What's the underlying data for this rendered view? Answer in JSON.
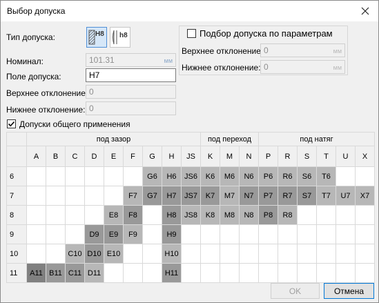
{
  "window": {
    "title": "Выбор допуска"
  },
  "form": {
    "tol_type_label": "Тип допуска:",
    "tol_hole_label": "H8",
    "tol_shaft_label": "h8",
    "nominal_label": "Номинал:",
    "nominal_value": "101.31",
    "unit": "мм",
    "field_label": "Поле допуска:",
    "field_value": "H7",
    "upper_label": "Верхнее отклонение:",
    "upper_value": "0",
    "lower_label": "Нижнее отклонение:",
    "lower_value": "0",
    "general_label": "Допуски общего применения"
  },
  "params": {
    "checkbox_label": "Подбор допуска по параметрам",
    "upper_label": "Верхнее отклонение:",
    "upper_value": "0",
    "lower_label": "Нижнее отклонение:",
    "lower_value": "0",
    "unit": "мм"
  },
  "grid": {
    "groups": [
      "под зазор",
      "под переход",
      "под натяг"
    ],
    "columns": [
      "A",
      "B",
      "C",
      "D",
      "E",
      "F",
      "G",
      "H",
      "JS",
      "K",
      "M",
      "N",
      "P",
      "R",
      "S",
      "T",
      "U",
      "X"
    ],
    "rows": [
      {
        "label": "6",
        "cells": [
          "",
          "",
          "",
          "",
          "",
          "",
          "G6",
          "H6",
          "JS6",
          "K6",
          "M6",
          "N6",
          "P6",
          "R6",
          "S6",
          "T6",
          "",
          ""
        ]
      },
      {
        "label": "7",
        "cells": [
          "",
          "",
          "",
          "",
          "",
          "F7",
          "G7",
          "H7",
          "JS7",
          "K7",
          "M7",
          "N7",
          "P7",
          "R7",
          "S7",
          "T7",
          "U7",
          "X7"
        ]
      },
      {
        "label": "8",
        "cells": [
          "",
          "",
          "",
          "",
          "E8",
          "F8",
          "",
          "H8",
          "JS8",
          "K8",
          "M8",
          "N8",
          "P8",
          "R8",
          "",
          "",
          "",
          ""
        ]
      },
      {
        "label": "9",
        "cells": [
          "",
          "",
          "",
          "D9",
          "E9",
          "F9",
          "",
          "H9",
          "",
          "",
          "",
          "",
          "",
          "",
          "",
          "",
          "",
          ""
        ]
      },
      {
        "label": "10",
        "cells": [
          "",
          "",
          "C10",
          "D10",
          "E10",
          "",
          "",
          "H10",
          "",
          "",
          "",
          "",
          "",
          "",
          "",
          "",
          "",
          ""
        ]
      },
      {
        "label": "11",
        "cells": [
          "A11",
          "B11",
          "C11",
          "D11",
          "",
          "",
          "",
          "H11",
          "",
          "",
          "",
          "",
          "",
          "",
          "",
          "",
          "",
          ""
        ]
      }
    ]
  },
  "buttons": {
    "ok": "OK",
    "cancel": "Отмена"
  }
}
